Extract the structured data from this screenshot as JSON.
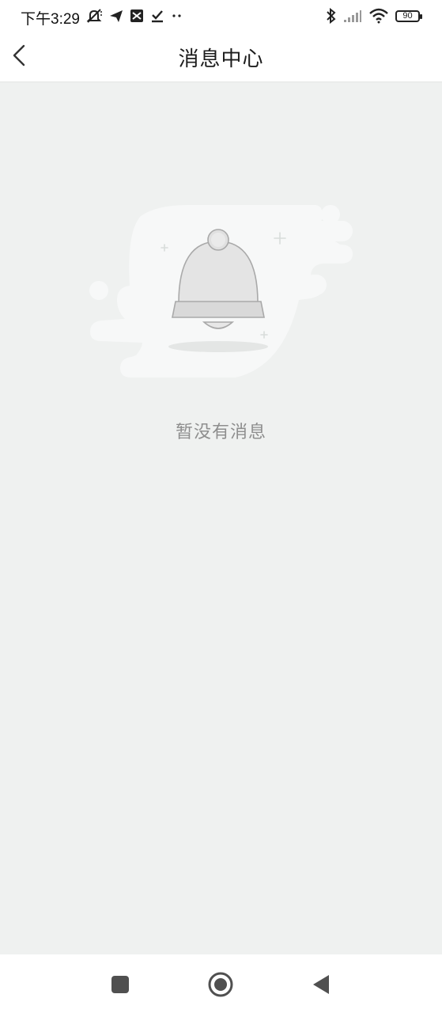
{
  "status_bar": {
    "time": "下午3:29",
    "left_icons": [
      "mute-bell-icon",
      "send-icon",
      "app-icon",
      "download-check-icon",
      "more-dots-icon"
    ],
    "right_icons": [
      "bluetooth-icon",
      "signal-icon",
      "wifi-icon",
      "battery-icon"
    ],
    "battery": "90"
  },
  "header": {
    "title": "消息中心",
    "back_icon": "chevron-left-icon"
  },
  "empty_state": {
    "illustration": "bell-icon",
    "message": "暂没有消息"
  },
  "system_nav": {
    "buttons": [
      "recent-apps-icon",
      "home-icon",
      "back-triangle-icon"
    ]
  },
  "colors": {
    "background": "#eff1f0",
    "header_bg": "#ffffff",
    "empty_text": "#8e8e8e"
  }
}
